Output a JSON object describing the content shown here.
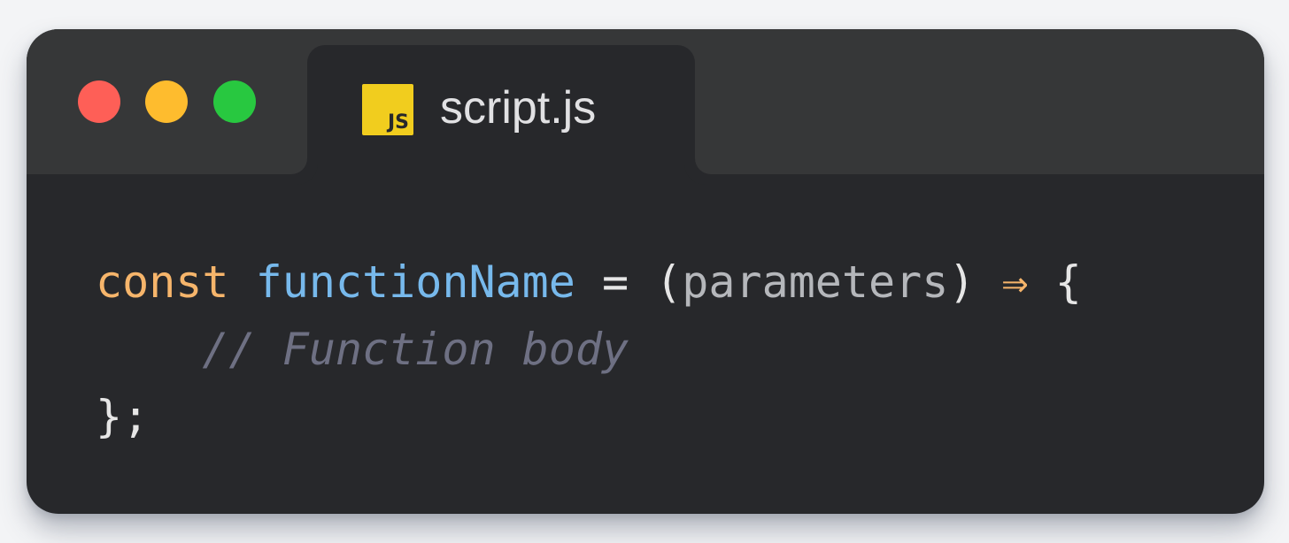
{
  "window": {
    "controls": [
      {
        "name": "close",
        "color": "#fe5f57"
      },
      {
        "name": "minimize",
        "color": "#febc2e"
      },
      {
        "name": "maximize",
        "color": "#28c840"
      }
    ]
  },
  "tab": {
    "icon_label": "JS",
    "icon_color": "#f1cd1e",
    "title": "script.js"
  },
  "code": {
    "line1": {
      "keyword": "const",
      "function_name": "functionName",
      "equals": "=",
      "paren_open": "(",
      "params": "parameters",
      "paren_close": ")",
      "arrow": "⇒",
      "brace_open": "{"
    },
    "line2": {
      "indent": "    ",
      "comment": "// Function body"
    },
    "line3": {
      "closing": "};"
    }
  }
}
